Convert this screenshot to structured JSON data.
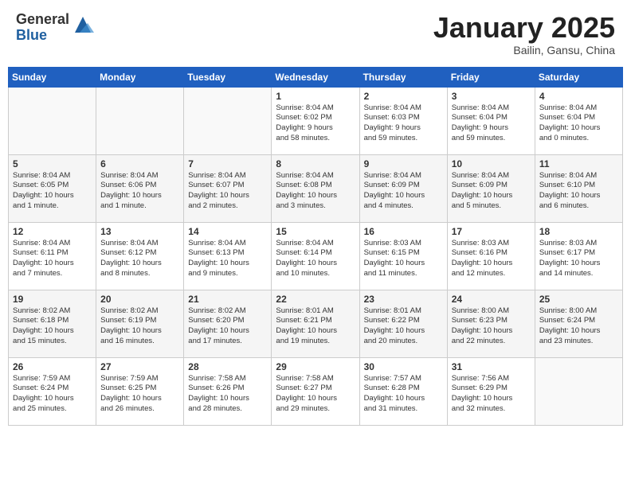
{
  "header": {
    "logo_general": "General",
    "logo_blue": "Blue",
    "month_title": "January 2025",
    "location": "Bailin, Gansu, China"
  },
  "weekdays": [
    "Sunday",
    "Monday",
    "Tuesday",
    "Wednesday",
    "Thursday",
    "Friday",
    "Saturday"
  ],
  "weeks": [
    [
      {
        "day": "",
        "info": ""
      },
      {
        "day": "",
        "info": ""
      },
      {
        "day": "",
        "info": ""
      },
      {
        "day": "1",
        "info": "Sunrise: 8:04 AM\nSunset: 6:02 PM\nDaylight: 9 hours\nand 58 minutes."
      },
      {
        "day": "2",
        "info": "Sunrise: 8:04 AM\nSunset: 6:03 PM\nDaylight: 9 hours\nand 59 minutes."
      },
      {
        "day": "3",
        "info": "Sunrise: 8:04 AM\nSunset: 6:04 PM\nDaylight: 9 hours\nand 59 minutes."
      },
      {
        "day": "4",
        "info": "Sunrise: 8:04 AM\nSunset: 6:04 PM\nDaylight: 10 hours\nand 0 minutes."
      }
    ],
    [
      {
        "day": "5",
        "info": "Sunrise: 8:04 AM\nSunset: 6:05 PM\nDaylight: 10 hours\nand 1 minute."
      },
      {
        "day": "6",
        "info": "Sunrise: 8:04 AM\nSunset: 6:06 PM\nDaylight: 10 hours\nand 1 minute."
      },
      {
        "day": "7",
        "info": "Sunrise: 8:04 AM\nSunset: 6:07 PM\nDaylight: 10 hours\nand 2 minutes."
      },
      {
        "day": "8",
        "info": "Sunrise: 8:04 AM\nSunset: 6:08 PM\nDaylight: 10 hours\nand 3 minutes."
      },
      {
        "day": "9",
        "info": "Sunrise: 8:04 AM\nSunset: 6:09 PM\nDaylight: 10 hours\nand 4 minutes."
      },
      {
        "day": "10",
        "info": "Sunrise: 8:04 AM\nSunset: 6:09 PM\nDaylight: 10 hours\nand 5 minutes."
      },
      {
        "day": "11",
        "info": "Sunrise: 8:04 AM\nSunset: 6:10 PM\nDaylight: 10 hours\nand 6 minutes."
      }
    ],
    [
      {
        "day": "12",
        "info": "Sunrise: 8:04 AM\nSunset: 6:11 PM\nDaylight: 10 hours\nand 7 minutes."
      },
      {
        "day": "13",
        "info": "Sunrise: 8:04 AM\nSunset: 6:12 PM\nDaylight: 10 hours\nand 8 minutes."
      },
      {
        "day": "14",
        "info": "Sunrise: 8:04 AM\nSunset: 6:13 PM\nDaylight: 10 hours\nand 9 minutes."
      },
      {
        "day": "15",
        "info": "Sunrise: 8:04 AM\nSunset: 6:14 PM\nDaylight: 10 hours\nand 10 minutes."
      },
      {
        "day": "16",
        "info": "Sunrise: 8:03 AM\nSunset: 6:15 PM\nDaylight: 10 hours\nand 11 minutes."
      },
      {
        "day": "17",
        "info": "Sunrise: 8:03 AM\nSunset: 6:16 PM\nDaylight: 10 hours\nand 12 minutes."
      },
      {
        "day": "18",
        "info": "Sunrise: 8:03 AM\nSunset: 6:17 PM\nDaylight: 10 hours\nand 14 minutes."
      }
    ],
    [
      {
        "day": "19",
        "info": "Sunrise: 8:02 AM\nSunset: 6:18 PM\nDaylight: 10 hours\nand 15 minutes."
      },
      {
        "day": "20",
        "info": "Sunrise: 8:02 AM\nSunset: 6:19 PM\nDaylight: 10 hours\nand 16 minutes."
      },
      {
        "day": "21",
        "info": "Sunrise: 8:02 AM\nSunset: 6:20 PM\nDaylight: 10 hours\nand 17 minutes."
      },
      {
        "day": "22",
        "info": "Sunrise: 8:01 AM\nSunset: 6:21 PM\nDaylight: 10 hours\nand 19 minutes."
      },
      {
        "day": "23",
        "info": "Sunrise: 8:01 AM\nSunset: 6:22 PM\nDaylight: 10 hours\nand 20 minutes."
      },
      {
        "day": "24",
        "info": "Sunrise: 8:00 AM\nSunset: 6:23 PM\nDaylight: 10 hours\nand 22 minutes."
      },
      {
        "day": "25",
        "info": "Sunrise: 8:00 AM\nSunset: 6:24 PM\nDaylight: 10 hours\nand 23 minutes."
      }
    ],
    [
      {
        "day": "26",
        "info": "Sunrise: 7:59 AM\nSunset: 6:24 PM\nDaylight: 10 hours\nand 25 minutes."
      },
      {
        "day": "27",
        "info": "Sunrise: 7:59 AM\nSunset: 6:25 PM\nDaylight: 10 hours\nand 26 minutes."
      },
      {
        "day": "28",
        "info": "Sunrise: 7:58 AM\nSunset: 6:26 PM\nDaylight: 10 hours\nand 28 minutes."
      },
      {
        "day": "29",
        "info": "Sunrise: 7:58 AM\nSunset: 6:27 PM\nDaylight: 10 hours\nand 29 minutes."
      },
      {
        "day": "30",
        "info": "Sunrise: 7:57 AM\nSunset: 6:28 PM\nDaylight: 10 hours\nand 31 minutes."
      },
      {
        "day": "31",
        "info": "Sunrise: 7:56 AM\nSunset: 6:29 PM\nDaylight: 10 hours\nand 32 minutes."
      },
      {
        "day": "",
        "info": ""
      }
    ]
  ]
}
